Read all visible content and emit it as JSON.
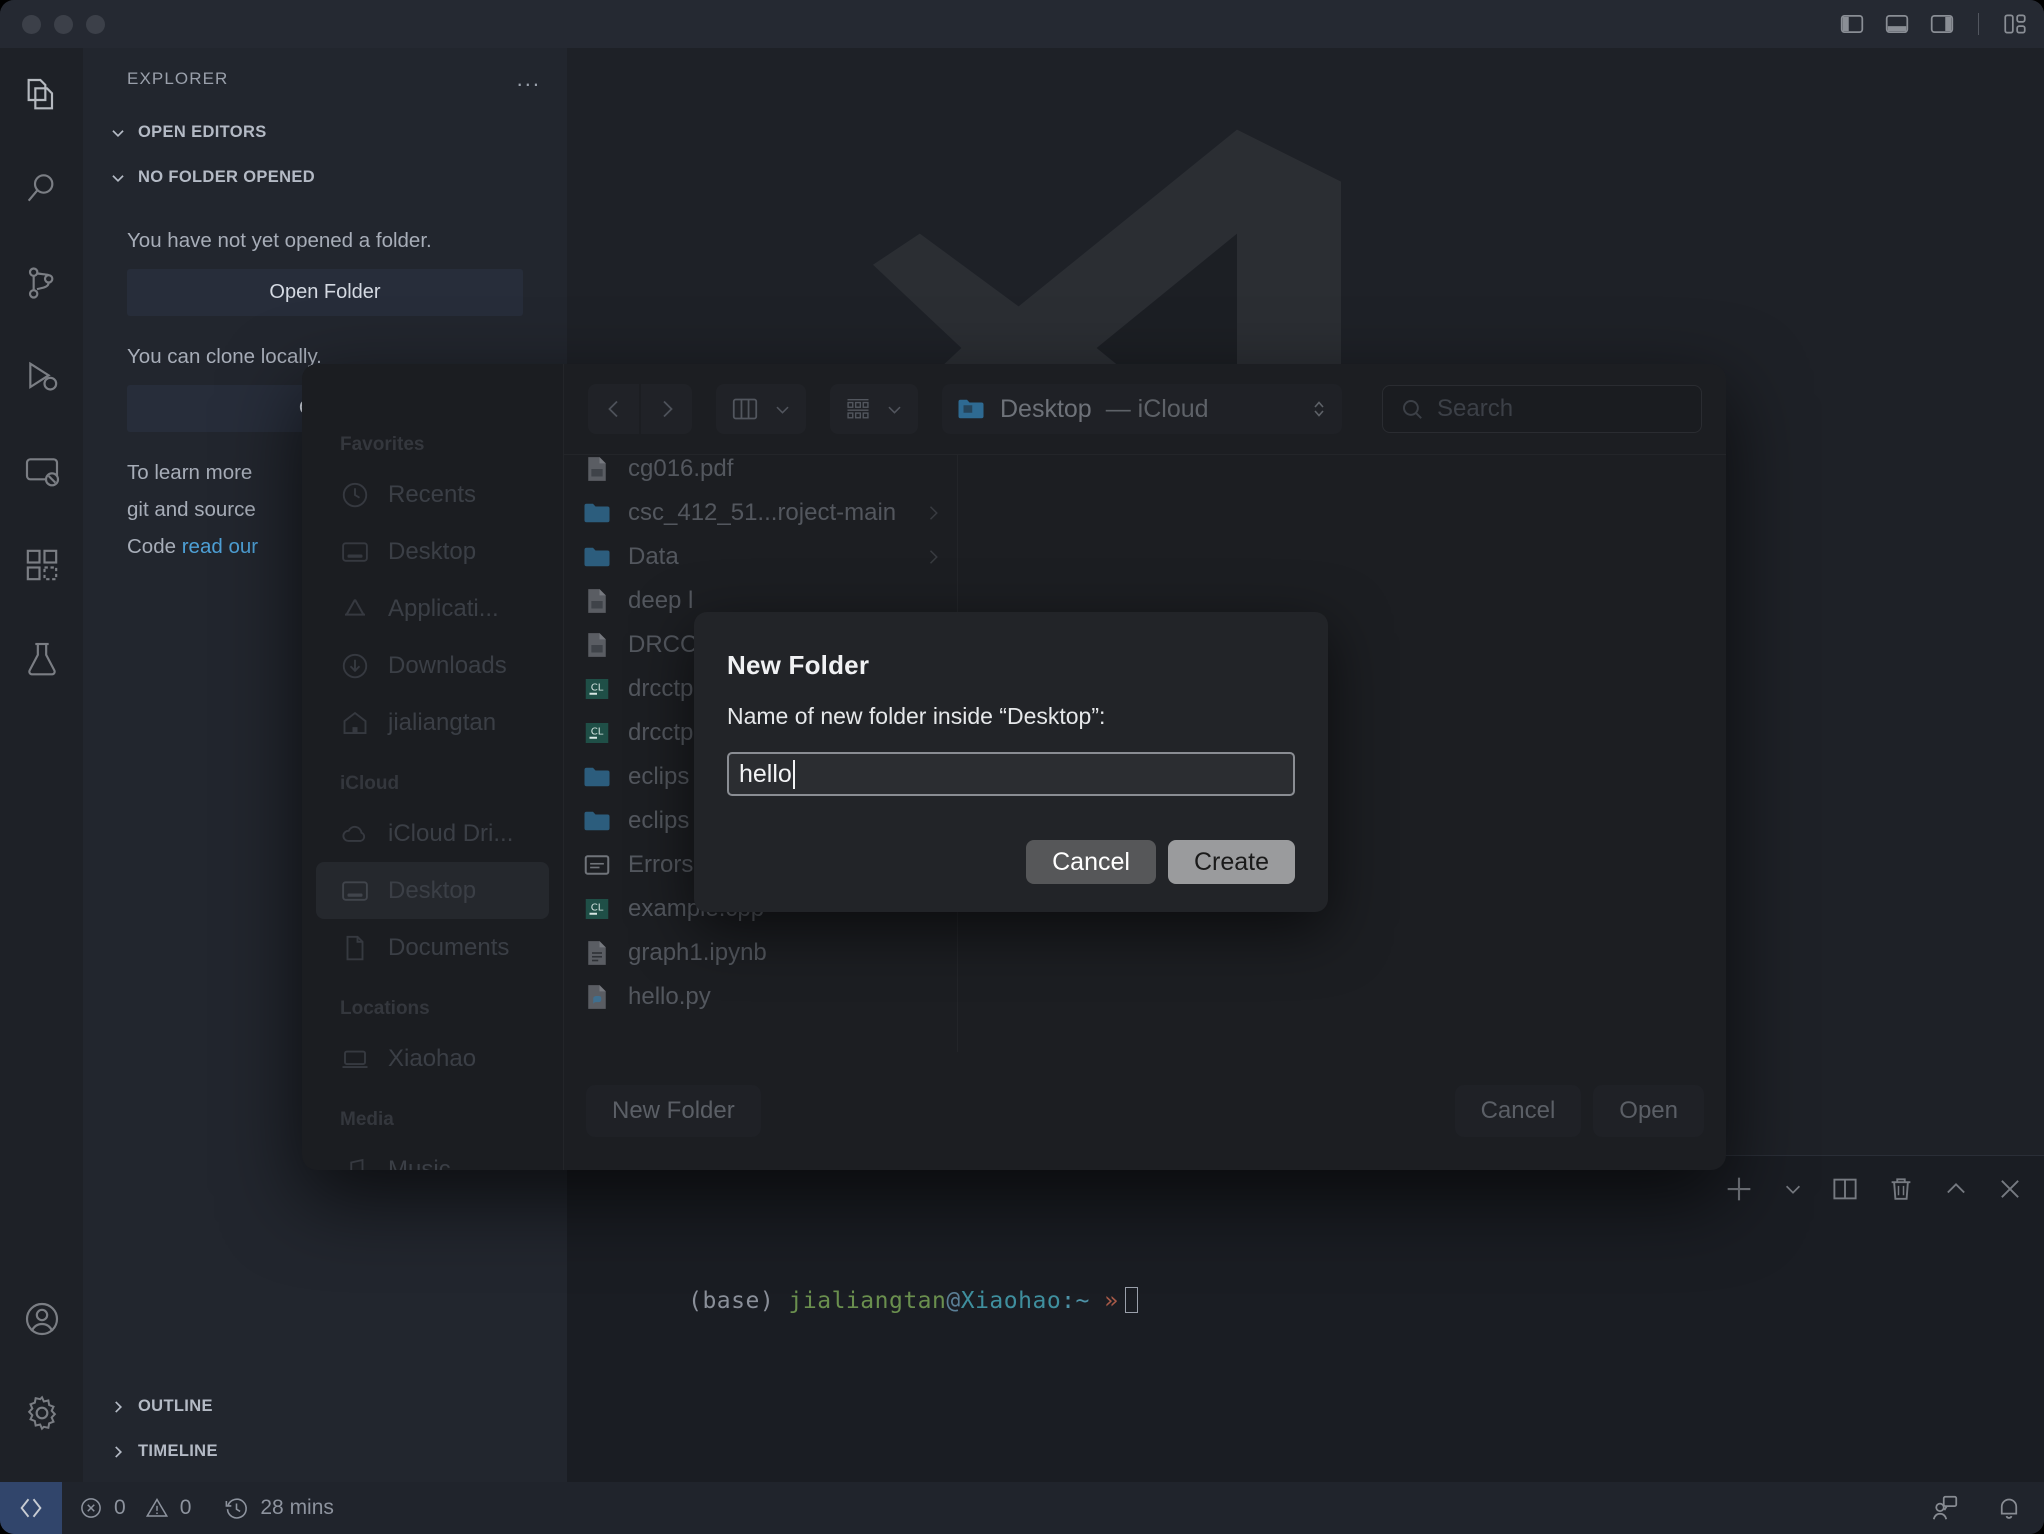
{
  "titlebar": {
    "traffic_lights": [
      "close",
      "minimize",
      "maximize"
    ],
    "layout_icons": [
      "layout-sidebar-left-icon",
      "layout-panel-icon",
      "layout-sidebar-right-icon",
      "customize-layout-icon"
    ]
  },
  "activitybar": {
    "items": [
      {
        "name": "explorer",
        "icon": "files-icon",
        "active": true
      },
      {
        "name": "search",
        "icon": "search-icon",
        "active": false
      },
      {
        "name": "source-control",
        "icon": "source-control-icon",
        "active": false
      },
      {
        "name": "run-and-debug",
        "icon": "debug-icon",
        "active": false
      },
      {
        "name": "remote-explorer",
        "icon": "remote-icon",
        "active": false
      },
      {
        "name": "extensions",
        "icon": "extensions-icon",
        "active": false
      },
      {
        "name": "testing",
        "icon": "beaker-icon",
        "active": false
      }
    ],
    "bottom_items": [
      {
        "name": "accounts",
        "icon": "account-icon"
      },
      {
        "name": "settings",
        "icon": "gear-icon"
      }
    ]
  },
  "sidebar": {
    "title": "EXPLORER",
    "more_actions": "...",
    "sections": [
      {
        "label": "OPEN EDITORS",
        "expanded": true
      },
      {
        "label": "NO FOLDER OPENED",
        "expanded": true
      }
    ],
    "no_folder_text": "You have not yet opened a folder.",
    "open_folder_button": "Open Folder",
    "clone_text": "You can clone locally.",
    "clone_button": "Clone",
    "learn_text_1": "To learn more",
    "learn_text_2": "git and source",
    "learn_text_3": "Code ",
    "learn_link": "read our",
    "bottom_sections": [
      {
        "label": "OUTLINE",
        "expanded": false
      },
      {
        "label": "TIMELINE",
        "expanded": false
      }
    ]
  },
  "panel": {
    "toolbar_icons": [
      "add-terminal-icon",
      "chevron-down-icon",
      "split-terminal-icon",
      "kill-terminal-icon",
      "maximize-panel-icon",
      "close-panel-icon"
    ],
    "terminal": {
      "env": "(base)",
      "user": "jialiangtan",
      "at": "@",
      "host": "Xiaohao",
      "colon_path": ":~",
      "arrow": "»"
    }
  },
  "statusbar": {
    "remote_icon": "remote-indicator-icon",
    "errors_icon": "error-icon",
    "errors": "0",
    "warnings_icon": "warning-icon",
    "warnings": "0",
    "timer_icon": "history-icon",
    "uptime": "28 mins",
    "right_icons": [
      "live-share-icon",
      "bell-icon"
    ]
  },
  "file_dialog": {
    "toolbar": {
      "back_icon": "chevron-left-icon",
      "forward_icon": "chevron-right-icon",
      "view_mode_icon": "column-view-icon",
      "view_mode_chevron": "chevron-down-icon",
      "group_icon": "grid-view-icon",
      "group_chevron": "chevron-down-icon",
      "path_icon": "folder-icon",
      "path_label": "Desktop",
      "path_location": "— iCloud",
      "path_stepper_icon": "stepper-icon",
      "search_icon": "search-icon",
      "search_placeholder": "Search"
    },
    "sidebar_groups": [
      {
        "title": "Favorites",
        "items": [
          {
            "label": "Recents",
            "icon": "clock-icon",
            "selected": false
          },
          {
            "label": "Desktop",
            "icon": "desktop-icon",
            "selected": false
          },
          {
            "label": "Applicati...",
            "icon": "applications-icon",
            "selected": false
          },
          {
            "label": "Downloads",
            "icon": "downloads-icon",
            "selected": false
          },
          {
            "label": "jialiangtan",
            "icon": "home-icon",
            "selected": false
          }
        ]
      },
      {
        "title": "iCloud",
        "items": [
          {
            "label": "iCloud Dri...",
            "icon": "cloud-icon",
            "selected": false
          },
          {
            "label": "Desktop",
            "icon": "desktop-icon",
            "selected": true
          },
          {
            "label": "Documents",
            "icon": "document-icon",
            "selected": false
          }
        ]
      },
      {
        "title": "Locations",
        "items": [
          {
            "label": "Xiaohao",
            "icon": "laptop-icon",
            "selected": false
          }
        ]
      },
      {
        "title": "Media",
        "items": [
          {
            "label": "Music",
            "icon": "music-icon",
            "selected": false
          }
        ]
      }
    ],
    "files": [
      {
        "name": "cg016.pdf",
        "icon": "pdf-icon",
        "has_chevron": false
      },
      {
        "name": "csc_412_51...roject-main",
        "icon": "folder-icon",
        "has_chevron": true
      },
      {
        "name": "Data",
        "icon": "folder-icon",
        "has_chevron": true
      },
      {
        "name": "deep l",
        "icon": "pdf-icon",
        "has_chevron": false
      },
      {
        "name": "DRCC",
        "icon": "pdf-icon",
        "has_chevron": false
      },
      {
        "name": "drcctp",
        "icon": "clion-icon",
        "has_chevron": false
      },
      {
        "name": "drcctp",
        "icon": "clion-icon",
        "has_chevron": false
      },
      {
        "name": "eclips",
        "icon": "folder-icon",
        "has_chevron": false
      },
      {
        "name": "eclips",
        "icon": "folder-icon",
        "has_chevron": false
      },
      {
        "name": "Errors",
        "icon": "text-icon",
        "has_chevron": false
      },
      {
        "name": "example.cpp",
        "icon": "clion-icon",
        "has_chevron": false
      },
      {
        "name": "graph1.ipynb",
        "icon": "notebook-icon",
        "has_chevron": false
      },
      {
        "name": "hello.py",
        "icon": "python-icon",
        "has_chevron": false
      }
    ],
    "footer": {
      "new_folder_button": "New Folder",
      "cancel_button": "Cancel",
      "open_button": "Open"
    }
  },
  "new_folder_sheet": {
    "title": "New Folder",
    "label": "Name of new folder inside “Desktop”:",
    "input_value": "hello",
    "cancel_button": "Cancel",
    "create_button": "Create"
  },
  "colors": {
    "accent_blue": "#31456b",
    "link_blue": "#4ea0d6",
    "create_button": "#9a9b9d",
    "cancel_button": "#565759"
  }
}
